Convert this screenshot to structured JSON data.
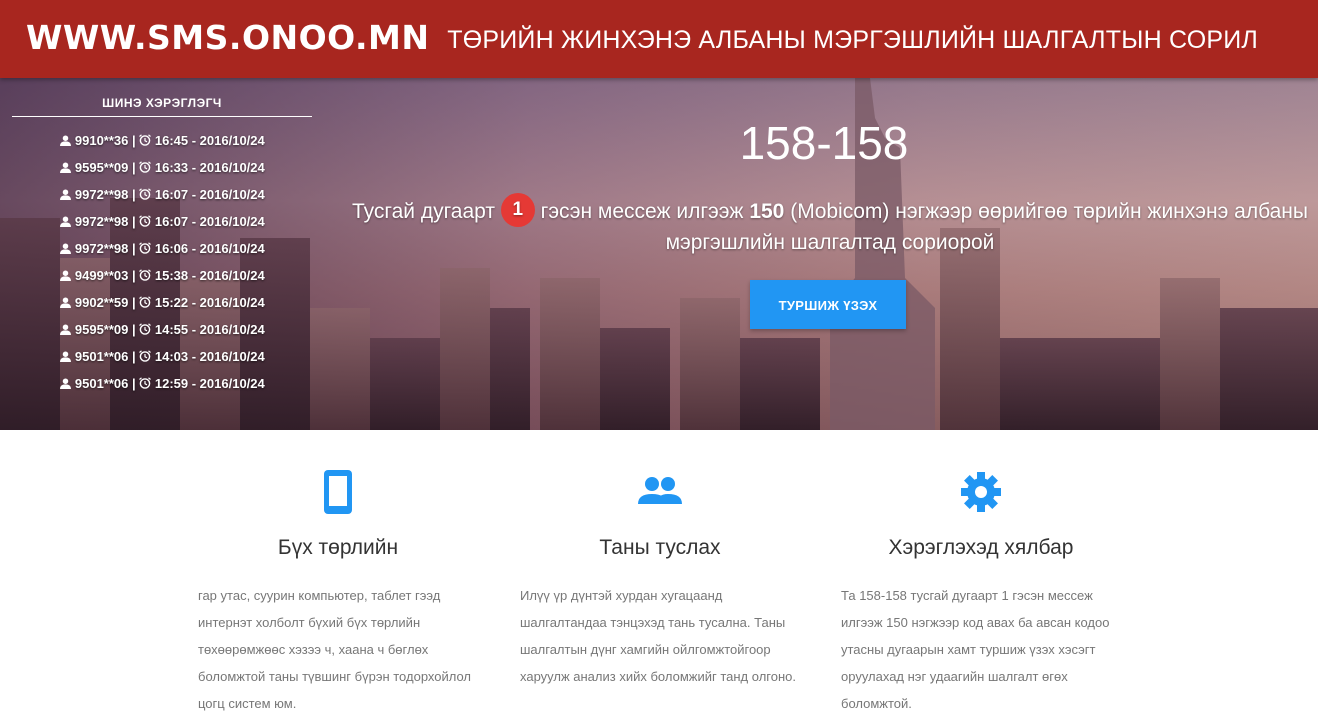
{
  "header": {
    "logo": "WWW.SMS.ONOO.MN",
    "title": "ТӨРИЙН ЖИНХЭНЭ АЛБАНЫ МЭРГЭШЛИЙН ШАЛГАЛТЫН СОРИЛ"
  },
  "sidebar": {
    "title": "ШИНЭ ХЭРЭГЛЭГЧ",
    "users": [
      {
        "phone": "9910**36",
        "time": "16:45 - 2016/10/24"
      },
      {
        "phone": "9595**09",
        "time": "16:33 - 2016/10/24"
      },
      {
        "phone": "9972**98",
        "time": "16:07 - 2016/10/24"
      },
      {
        "phone": "9972**98",
        "time": "16:07 - 2016/10/24"
      },
      {
        "phone": "9972**98",
        "time": "16:06 - 2016/10/24"
      },
      {
        "phone": "9499**03",
        "time": "15:38 - 2016/10/24"
      },
      {
        "phone": "9902**59",
        "time": "15:22 - 2016/10/24"
      },
      {
        "phone": "9595**09",
        "time": "14:55 - 2016/10/24"
      },
      {
        "phone": "9501**06",
        "time": "14:03 - 2016/10/24"
      },
      {
        "phone": "9501**06",
        "time": "12:59 - 2016/10/24"
      }
    ]
  },
  "hero": {
    "number": "158-158",
    "desc_pre": "Тусгай дугаарт ",
    "badge": "1",
    "desc_mid": " гэсэн мессеж илгээж ",
    "desc_bold": "150",
    "desc_post": " (Mobicom) нэгжээр өөрийгөө төрийн жинхэнэ албаны мэргэшлийн шалгалтад сориорой",
    "button": "ТУРШИЖ ҮЗЭХ"
  },
  "features": [
    {
      "icon": "smartphone-icon",
      "title": "Бүх төрлийн",
      "text": "гар утас, суурин компьютер, таблет гээд интернэт холболт бүхий бүх төрлийн төхөөрөмжөөс хэзээ ч, хаана ч бөглөх боломжтой таны түвшинг бүрэн тодорхойлол цогц систем юм."
    },
    {
      "icon": "people-icon",
      "title": "Таны туслах",
      "text": "Илүү үр дүнтэй хурдан хугацаанд шалгалтандаа тэнцэхэд тань тусална. Таны шалгалтын дүнг хамгийн ойлгомжтойгоор харуулж анализ хийх боломжийг танд олгоно."
    },
    {
      "icon": "gear-icon",
      "title": "Хэрэглэхэд хялбар",
      "text": "Та 158-158 тусгай дугаарт 1 гэсэн мессеж илгээж 150 нэгжээр код авах ба авсан кодоо утасны дугаарын хамт туршиж үзэх хэсэгт оруулахад нэг удаагийн шалгалт өгөх боломжтой."
    }
  ],
  "colors": {
    "header": "#a8261f",
    "accent": "#2196f3",
    "badge": "#e53935"
  }
}
